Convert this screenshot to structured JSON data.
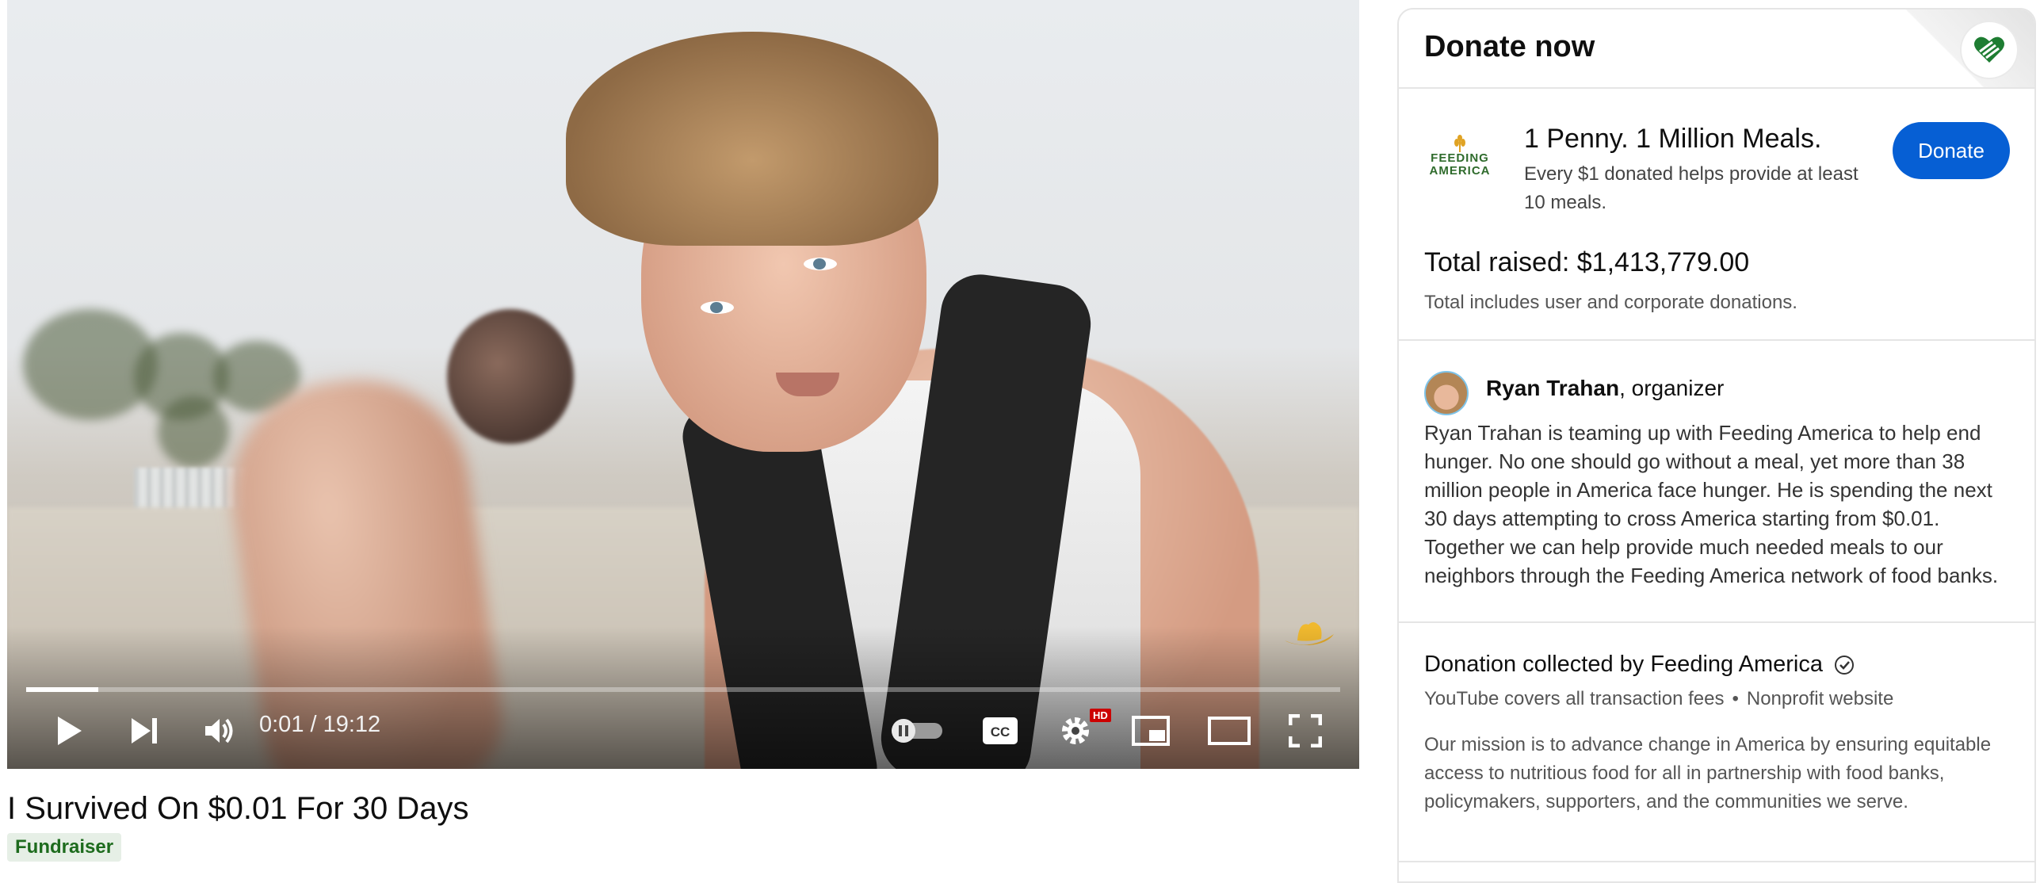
{
  "video": {
    "time_display": "0:01 / 19:12",
    "progress_fraction": 0.055,
    "hd_badge": "HD",
    "title": "I Survived On $0.01 For 30 Days",
    "chip": "Fundraiser"
  },
  "panel": {
    "title": "Donate now",
    "campaign": {
      "logo_text_line1": "FEEDING",
      "logo_text_line2": "AMERICA",
      "name": "1 Penny. 1 Million Meals.",
      "description": "Every $1 donated helps provide at least 10 meals.",
      "donate_label": "Donate",
      "total_raised": "Total raised: $1,413,779.00",
      "total_note": "Total includes user and corporate donations."
    },
    "organizer": {
      "name": "Ryan Trahan",
      "role": ", organizer",
      "description": "Ryan Trahan is teaming up with Feeding America to help end hunger. No one should go without a meal, yet more than 38 million people in America face hunger. He is spending the next 30 days attempting to cross America starting from $0.01. Together we can help provide much needed meals to our neighbors through the Feeding America network of food banks."
    },
    "collected": {
      "title": "Donation collected by Feeding America",
      "fees": "YouTube covers all transaction fees",
      "separator": "•",
      "website_link": "Nonprofit website",
      "mission": "Our mission is to advance change in America by ensuring equitable access to nutritious food for all in partnership with food banks, policymakers, supporters, and the communities we serve."
    }
  },
  "colors": {
    "donate_button": "#065fd4",
    "chip_bg": "#e6efe6",
    "chip_text": "#1d6b1d",
    "hd_badge": "#cc0000"
  },
  "icons": [
    "play-icon",
    "skip-next-icon",
    "volume-icon",
    "autoplay-toggle-icon",
    "captions-icon",
    "settings-icon",
    "miniplayer-icon",
    "theater-icon",
    "fullscreen-icon",
    "heart-hand-icon",
    "verified-check-icon",
    "cowboy-hat-icon"
  ]
}
